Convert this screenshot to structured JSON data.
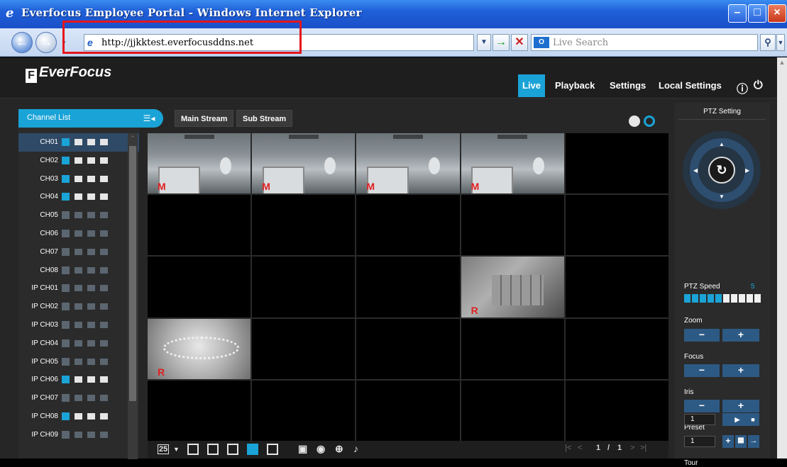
{
  "window": {
    "title": "Everfocus Employee Portal - Windows Internet Explorer",
    "address_url": "http://jjkktest.everfocusddns.net",
    "search_placeholder": "Live Search",
    "minimize": "–",
    "maximize": "□",
    "close": "×"
  },
  "app": {
    "logo_text": "EverFocus",
    "nav": [
      "Live",
      "Playback",
      "Settings",
      "Local Settings"
    ],
    "active_nav": "Live",
    "accent_color": "#1aa3d6"
  },
  "channel_list": {
    "header": "Channel List",
    "channels": [
      {
        "name": "CH01",
        "online": true,
        "selected": true
      },
      {
        "name": "CH02",
        "online": true
      },
      {
        "name": "CH03",
        "online": true
      },
      {
        "name": "CH04",
        "online": true
      },
      {
        "name": "CH05",
        "online": false
      },
      {
        "name": "CH06",
        "online": false
      },
      {
        "name": "CH07",
        "online": false
      },
      {
        "name": "CH08",
        "online": false
      },
      {
        "name": "IP CH01",
        "online": false
      },
      {
        "name": "IP CH02",
        "online": false
      },
      {
        "name": "IP CH03",
        "online": false
      },
      {
        "name": "IP CH04",
        "online": false
      },
      {
        "name": "IP CH05",
        "online": false
      },
      {
        "name": "IP CH06",
        "online": true
      },
      {
        "name": "IP CH07",
        "online": false
      },
      {
        "name": "IP CH08",
        "online": true
      },
      {
        "name": "IP CH09",
        "online": false
      }
    ]
  },
  "stream": {
    "main": "Main Stream",
    "sub": "Sub Stream"
  },
  "grid": {
    "cells": [
      {
        "feed": "office",
        "tag": "M",
        "selected": true
      },
      {
        "feed": "office",
        "tag": "M"
      },
      {
        "feed": "office",
        "tag": "M"
      },
      {
        "feed": "office",
        "tag": "M"
      },
      {
        "feed": "",
        "tag": ""
      },
      {
        "feed": "",
        "tag": ""
      },
      {
        "feed": "",
        "tag": ""
      },
      {
        "feed": "",
        "tag": ""
      },
      {
        "feed": "",
        "tag": ""
      },
      {
        "feed": "",
        "tag": ""
      },
      {
        "feed": "",
        "tag": ""
      },
      {
        "feed": "",
        "tag": ""
      },
      {
        "feed": "",
        "tag": ""
      },
      {
        "feed": "storage",
        "tag": "R"
      },
      {
        "feed": "",
        "tag": ""
      },
      {
        "feed": "baby",
        "tag": "R"
      },
      {
        "feed": "",
        "tag": ""
      },
      {
        "feed": "",
        "tag": ""
      },
      {
        "feed": "",
        "tag": ""
      },
      {
        "feed": "",
        "tag": ""
      },
      {
        "feed": "",
        "tag": ""
      },
      {
        "feed": "",
        "tag": ""
      },
      {
        "feed": "",
        "tag": ""
      },
      {
        "feed": "",
        "tag": ""
      },
      {
        "feed": "",
        "tag": ""
      }
    ]
  },
  "toolbar": {
    "layout_label": "25",
    "page_current": "1",
    "page_sep": "/",
    "page_total": "1"
  },
  "ptz": {
    "header": "PTZ Setting",
    "speed_label": "PTZ Speed",
    "speed_value": "5",
    "speed_level": 5,
    "speed_max": 10,
    "zoom_label": "Zoom",
    "focus_label": "Focus",
    "iris_label": "Iris",
    "preset_label": "Preset",
    "preset_value": "1",
    "tour_label": "Tour",
    "tour_value": "1",
    "minus": "−",
    "plus": "+"
  }
}
